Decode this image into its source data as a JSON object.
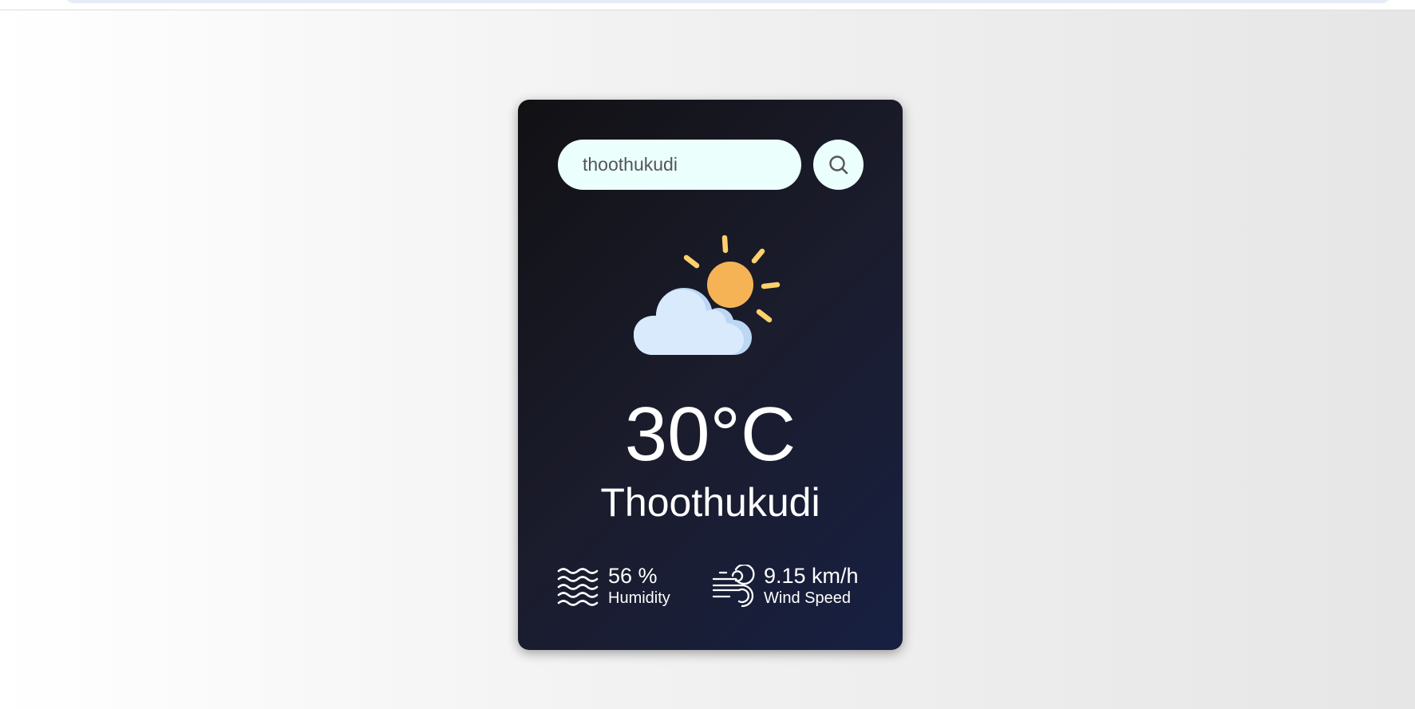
{
  "search": {
    "value": "thoothukudi",
    "button_icon": "search-icon"
  },
  "weather": {
    "icon": "partly-cloudy-sun-icon",
    "temperature": "30°C",
    "city": "Thoothukudi"
  },
  "details": {
    "humidity": {
      "icon": "humidity-waves-icon",
      "value": "56 %",
      "label": "Humidity"
    },
    "wind": {
      "icon": "wind-icon",
      "value": "9.15 km/h",
      "label": "Wind Speed"
    }
  },
  "colors": {
    "input_background": "#ebfffc",
    "card_start": "#111114",
    "card_end": "#172042",
    "sun": "#f5b356",
    "sun_rays": "#fdd06c",
    "cloud": "#d6e8fb"
  }
}
